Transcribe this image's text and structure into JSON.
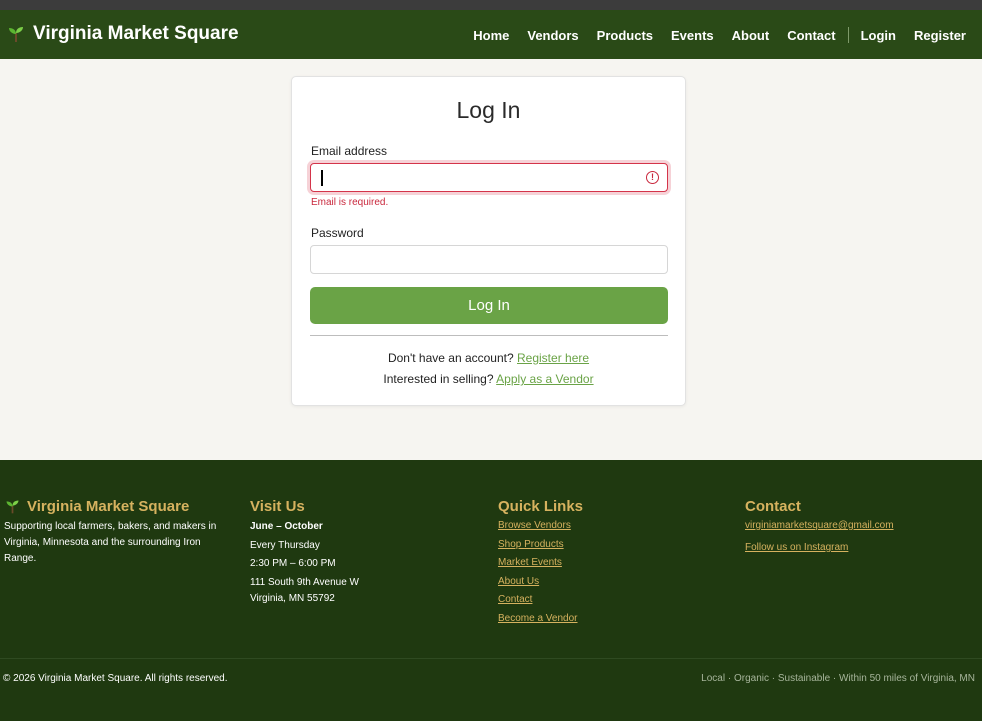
{
  "header": {
    "brand": "Virginia Market Square",
    "nav": [
      "Home",
      "Vendors",
      "Products",
      "Events",
      "About",
      "Contact"
    ],
    "auth": [
      "Login",
      "Register"
    ]
  },
  "login": {
    "title": "Log In",
    "email_label": "Email address",
    "email_value": "",
    "email_error": "Email is required.",
    "password_label": "Password",
    "password_value": "",
    "submit_label": "Log In",
    "register_prompt": "Don't have an account?",
    "register_link": "Register here",
    "vendor_prompt": "Interested in selling?",
    "vendor_link": "Apply as a Vendor"
  },
  "footer": {
    "brand": "Virginia Market Square",
    "about": "Supporting local farmers, bakers, and makers in Virginia, Minnesota and the surrounding Iron Range.",
    "visit": {
      "heading": "Visit Us",
      "season": "June – October",
      "day": "Every Thursday",
      "hours": "2:30 PM – 6:00 PM",
      "street": "111 South 9th Avenue W",
      "city": "Virginia, MN 55792"
    },
    "quick": {
      "heading": "Quick Links",
      "links": [
        "Browse Vendors",
        "Shop Products",
        "Market Events",
        "About Us",
        "Contact",
        "Become a Vendor"
      ]
    },
    "contact": {
      "heading": "Contact",
      "email": "virginiamarketsquare@gmail.com",
      "instagram": "Follow us on Instagram"
    },
    "copyright": "© 2026 Virginia Market Square. All rights reserved.",
    "tagline": "Local · Organic · Sustainable · Within 50 miles of Virginia, MN"
  },
  "colors": {
    "nav_bg": "#2a4a17",
    "footer_bg": "#1f3910",
    "accent": "#6aa346",
    "footer_heading": "#d6b25f",
    "error": "#c9283d"
  },
  "icons": [
    "sprout-icon",
    "error-icon"
  ]
}
